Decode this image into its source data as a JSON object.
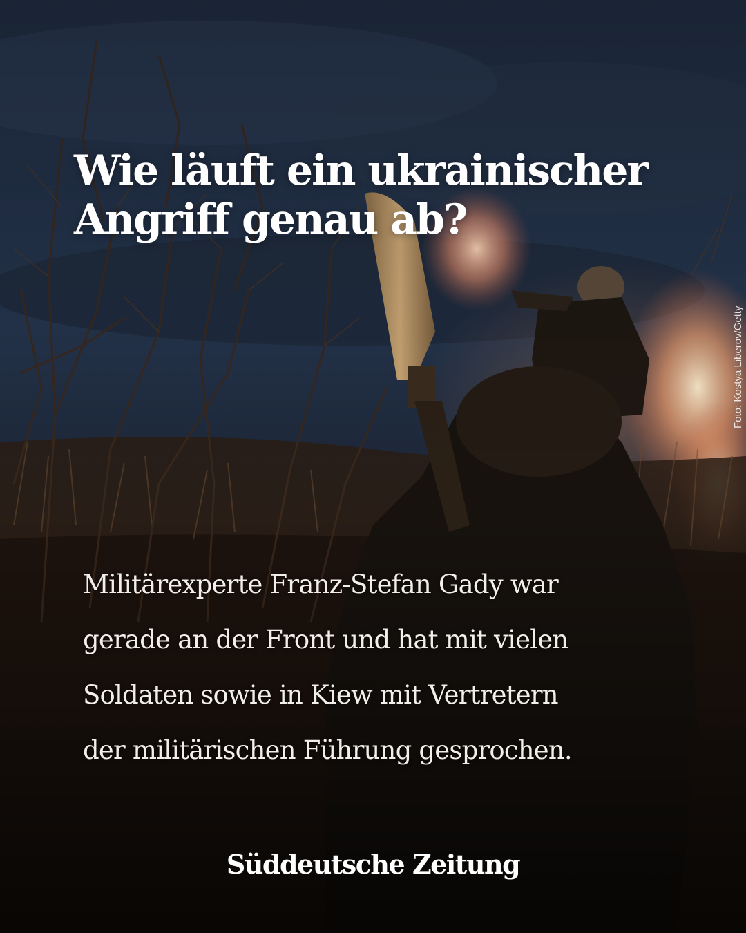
{
  "post": {
    "headline_lines": [
      "Wie läuft ein ukrainischer",
      "Angriff genau ab?"
    ],
    "body_lines": [
      "Militärexperte Franz-Stefan Gady war",
      "gerade an der Front und hat mit vielen",
      "Soldaten sowie in Kiew mit Vertretern",
      "der militärischen Führung gesprochen."
    ],
    "photo_credit": "Foto: Kostya Liberov/Getty",
    "brand": "Süddeutsche Zeitung"
  },
  "colors": {
    "sky": "#1f2c42",
    "ground": "#2a1d14",
    "flash": "#f2a178",
    "text": "#ffffff"
  },
  "photo": {
    "subject": "two soldiers firing weapons at dusk behind bare bushes"
  }
}
